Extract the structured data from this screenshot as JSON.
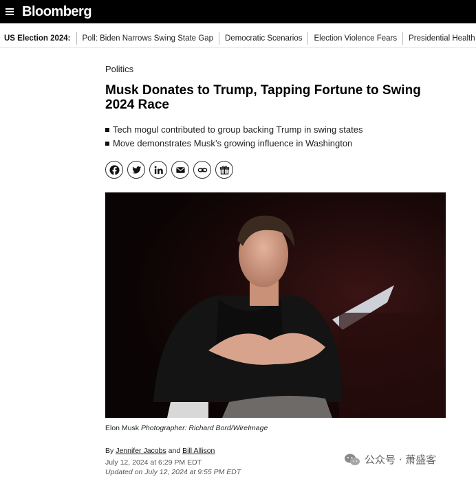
{
  "header": {
    "logo": "Bloomberg",
    "menu_icon": "hamburger-menu-icon"
  },
  "nav": {
    "label": "US Election 2024:",
    "items": [
      {
        "label": "Poll: Biden Narrows Swing State Gap"
      },
      {
        "label": "Democratic Scenarios"
      },
      {
        "label": "Election Violence Fears"
      },
      {
        "label": "Presidential Health"
      }
    ]
  },
  "article": {
    "kicker": "Politics",
    "headline": "Musk Donates to Trump, Tapping Fortune to Swing 2024 Race",
    "bullets": [
      "Tech mogul contributed to group backing Trump in swing states",
      "Move demonstrates Musk’s growing influence in Washington"
    ],
    "share_icons": [
      "facebook-icon",
      "twitter-icon",
      "linkedin-icon",
      "email-icon",
      "link-icon",
      "gift-icon"
    ],
    "caption_name": "Elon Musk",
    "caption_credit": "Photographer: Richard Bord/WireImage",
    "byline_prefix": "By",
    "author1": "Jennifer Jacobs",
    "byline_and": "and",
    "author2": "Bill Allison",
    "published": "July 12, 2024 at 6:29 PM EDT",
    "updated": "Updated on July 12, 2024 at 9:55 PM EDT"
  },
  "watermark": {
    "text": "公众号 · 萧盛客",
    "icon": "wechat-icon"
  },
  "colors": {
    "topbar": "#000000",
    "text": "#111111"
  }
}
